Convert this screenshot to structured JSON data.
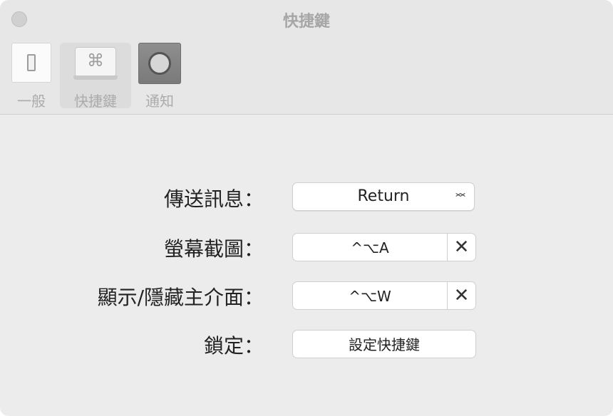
{
  "window": {
    "title": "快捷鍵"
  },
  "toolbar": {
    "items": [
      {
        "label": "一般",
        "icon": "switch-icon"
      },
      {
        "label": "快捷鍵",
        "icon": "command-key-icon",
        "selected": true
      },
      {
        "label": "通知",
        "icon": "notification-icon"
      }
    ],
    "cmd_glyph": "⌘"
  },
  "form": {
    "send_message": {
      "label": "傳送訊息：",
      "value": "Return",
      "arrows": "⌃⌄"
    },
    "screenshot": {
      "label": "螢幕截圖：",
      "shortcut": "^⌥A",
      "clear": "✕"
    },
    "show_hide": {
      "label": "顯示/隱藏主介面：",
      "shortcut": "^⌥W",
      "clear": "✕"
    },
    "lock": {
      "label": "鎖定：",
      "button": "設定快捷鍵"
    }
  }
}
